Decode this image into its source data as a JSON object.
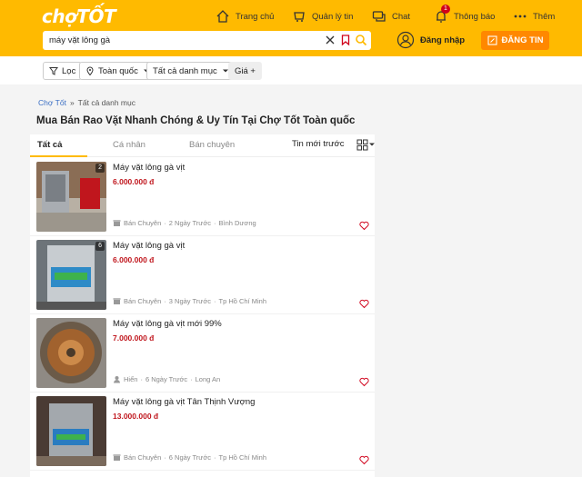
{
  "header": {
    "logo": "chợTỐT",
    "nav": [
      {
        "label": "Trang chủ",
        "icon": "home-icon"
      },
      {
        "label": "Quản lý tin",
        "icon": "manage-icon"
      },
      {
        "label": "Chat",
        "icon": "chat-icon"
      },
      {
        "label": "Thông báo",
        "icon": "bell-icon",
        "badge": "1"
      },
      {
        "label": "Thêm",
        "icon": "more-icon"
      }
    ],
    "search_value": "máy vặt lông gà",
    "login_label": "Đăng nhập",
    "post_label": "ĐĂNG TIN"
  },
  "filters": {
    "filter_label": "Lọc",
    "location_label": "Toàn quốc",
    "category_label": "Tất cả danh mục",
    "price_label": "Giá +"
  },
  "breadcrumb": {
    "home": "Chợ Tốt",
    "separator": "»",
    "current": "Tất cả danh mục"
  },
  "page_title": "Mua Bán Rao Vặt Nhanh Chóng & Uy Tín Tại Chợ Tốt Toàn quốc",
  "tabs": [
    {
      "label": "Tất cả",
      "active": true
    },
    {
      "label": "Cá nhân",
      "active": false
    },
    {
      "label": "Bán chuyên",
      "active": false
    }
  ],
  "sort_label": "Tin mới trước",
  "listings": [
    {
      "title": "Máy vặt lông gà vịt",
      "price": "6.000.000 đ",
      "seller": "Bán Chuyên",
      "time": "2 Ngày Trước",
      "location": "Bình Dương",
      "image_count": "2"
    },
    {
      "title": "Máy vặt lông gà vịt",
      "price": "6.000.000 đ",
      "seller": "Bán Chuyên",
      "time": "3 Ngày Trước",
      "location": "Tp Hồ Chí Minh",
      "image_count": "6"
    },
    {
      "title": "Máy vặt lông gà vịt mới 99%",
      "price": "7.000.000 đ",
      "seller": "Hiển",
      "time": "6 Ngày Trước",
      "location": "Long An",
      "image_count": ""
    },
    {
      "title": "Máy vặt lông gà vịt Tân Thịnh Vượng",
      "price": "13.000.000 đ",
      "seller": "Bán Chuyên",
      "time": "6 Ngày Trước",
      "location": "Tp Hồ Chí Minh",
      "image_count": ""
    }
  ],
  "colors": {
    "brand_yellow": "#ffba00",
    "post_orange": "#ff8800",
    "price_red": "#c0161d"
  }
}
